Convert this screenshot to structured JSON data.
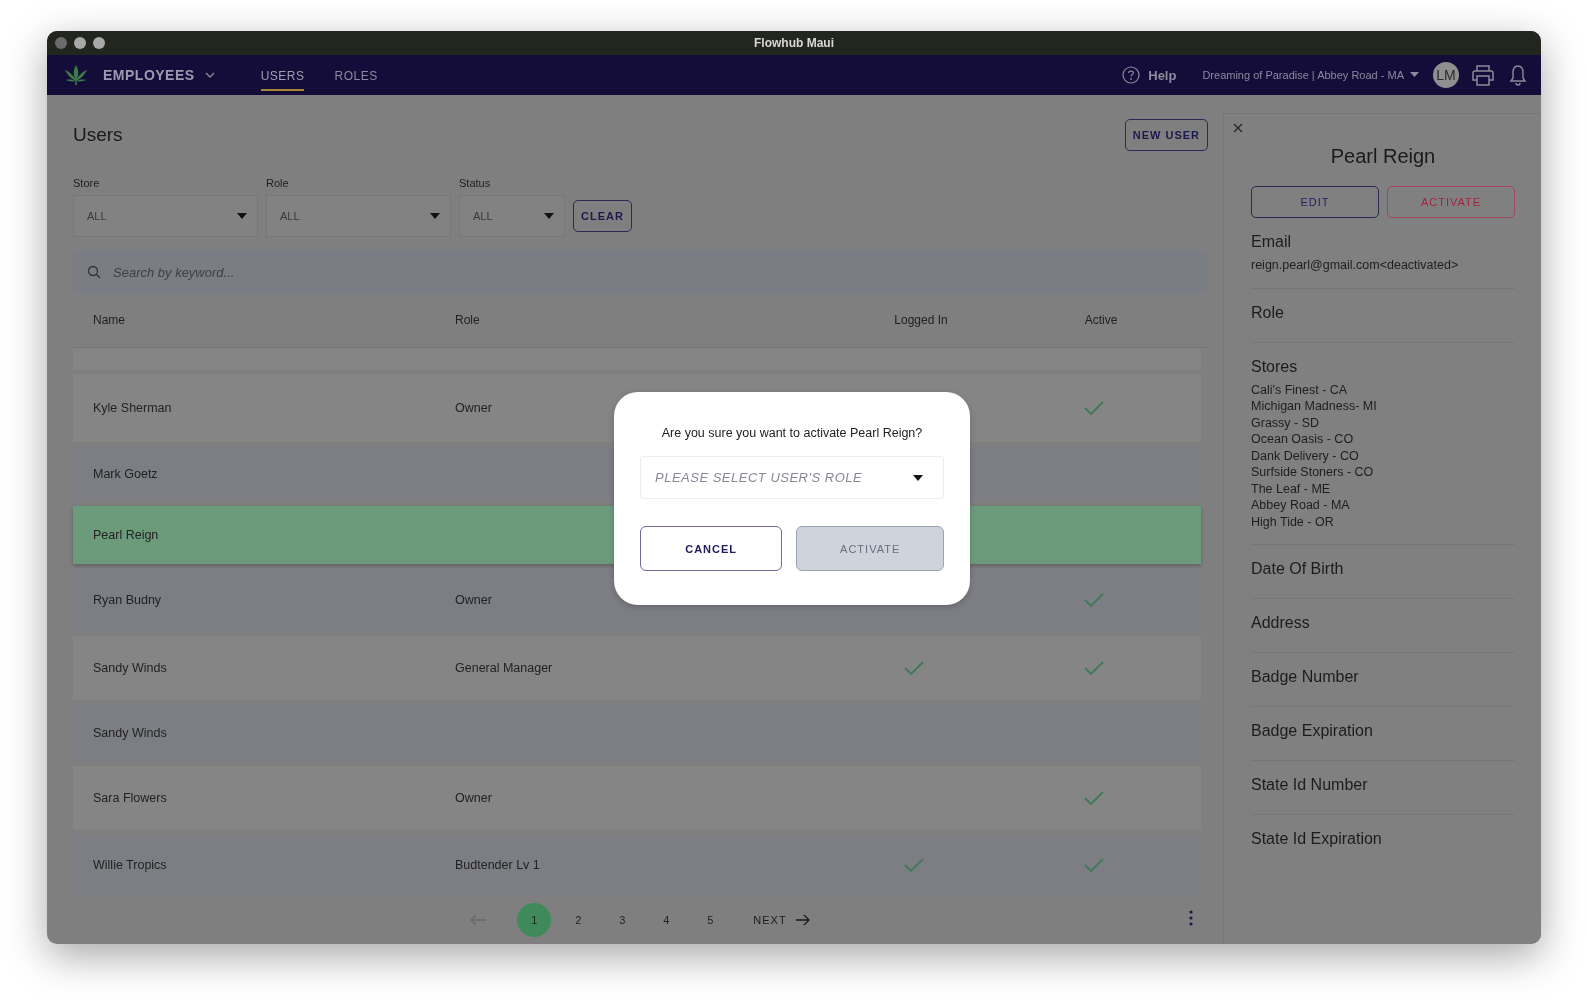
{
  "window": {
    "title": "Flowhub Maui"
  },
  "nav": {
    "section": "EMPLOYEES",
    "tabs": [
      {
        "label": "USERS",
        "selected": true
      },
      {
        "label": "ROLES",
        "selected": false
      }
    ],
    "help": "Help",
    "store": "Dreaming of Paradise | Abbey Road - MA",
    "avatar": "LM"
  },
  "page": {
    "title": "Users",
    "new_user_button": "NEW USER",
    "filters": [
      {
        "label": "Store",
        "value": "ALL"
      },
      {
        "label": "Role",
        "value": "ALL"
      },
      {
        "label": "Status",
        "value": "ALL"
      }
    ],
    "clear_button": "CLEAR",
    "search": {
      "placeholder": "Search by keyword..."
    },
    "table": {
      "columns": [
        "Name",
        "Role",
        "Logged In",
        "Active"
      ],
      "rows": [
        {
          "name": "Kyle Sherman",
          "role": "Owner",
          "logged_in": false,
          "active": true,
          "selected": false
        },
        {
          "name": "Mark Goetz",
          "logged_in": false,
          "active": false,
          "selected": false
        },
        {
          "name": "Pearl Reign",
          "logged_in": false,
          "active": false,
          "selected": true
        },
        {
          "name": "Ryan Budny",
          "role": "Owner",
          "logged_in": false,
          "active": true,
          "selected": false
        },
        {
          "name": "Sandy Winds",
          "role": "General Manager",
          "logged_in": true,
          "active": true,
          "selected": false
        },
        {
          "name": "Sandy Winds",
          "logged_in": false,
          "active": false,
          "selected": false
        },
        {
          "name": "Sara Flowers",
          "role": "Owner",
          "logged_in": false,
          "active": true,
          "selected": false
        },
        {
          "name": "Willie Tropics",
          "role": "Budtender Lv 1",
          "logged_in": true,
          "active": true,
          "selected": false
        }
      ]
    },
    "pagination": {
      "pages": [
        {
          "label": "1",
          "selected": true
        },
        {
          "label": "2",
          "selected": false
        },
        {
          "label": "3",
          "selected": false
        },
        {
          "label": "4",
          "selected": false
        },
        {
          "label": "5",
          "selected": false
        }
      ],
      "next": "NEXT"
    }
  },
  "panel": {
    "name": "Pearl Reign",
    "buttons": [
      {
        "label": "EDIT",
        "kind": "edit"
      },
      {
        "label": "ACTIVATE",
        "kind": "activate"
      }
    ],
    "fields": [
      {
        "label": "Email",
        "values": [
          "reign.pearl@gmail.com<deactivated>"
        ]
      },
      {
        "label": "Role"
      },
      {
        "label": "Stores",
        "values": [
          "Cali's Finest - CA",
          "Michigan Madness- MI",
          "Grassy - SD",
          "Ocean Oasis - CO",
          "Dank Delivery - CO",
          "Surfside Stoners - CO",
          "The Leaf - ME",
          "Abbey Road - MA",
          "High Tide - OR"
        ]
      },
      {
        "label": "Date Of Birth"
      },
      {
        "label": "Address"
      },
      {
        "label": "Badge Number"
      },
      {
        "label": "Badge Expiration"
      },
      {
        "label": "State Id Number"
      },
      {
        "label": "State Id Expiration"
      }
    ]
  },
  "modal": {
    "message": "Are you sure you want to activate Pearl Reign?",
    "select": {
      "placeholder": "PLEASE SELECT USER'S ROLE"
    },
    "buttons": [
      {
        "label": "CANCEL",
        "disabled": false
      },
      {
        "label": "ACTIVATE",
        "disabled": true
      }
    ]
  }
}
